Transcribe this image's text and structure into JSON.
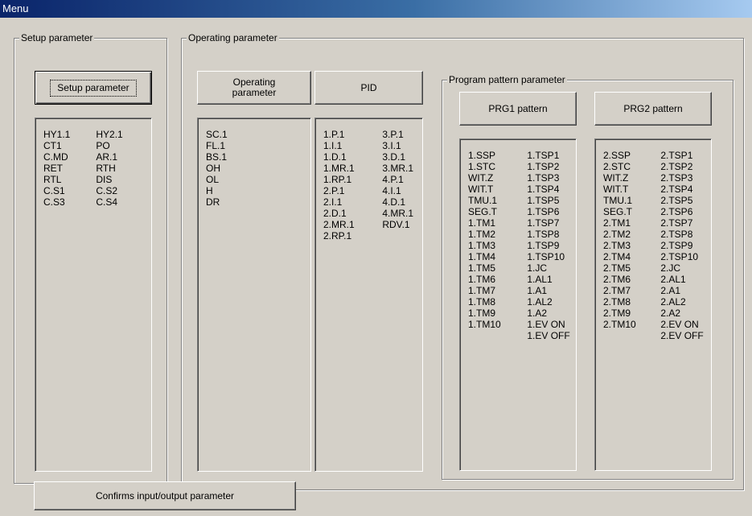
{
  "window": {
    "title": "Menu"
  },
  "setup_group": {
    "label": "Setup parameter",
    "button_label": "Setup parameter",
    "col1": [
      "HY1.1",
      "CT1",
      "C.MD",
      "RET",
      "RTL",
      "C.S1",
      "C.S3"
    ],
    "col2": [
      "HY2.1",
      "PO",
      "AR.1",
      "RTH",
      "DIS",
      "C.S2",
      "C.S4"
    ]
  },
  "operating_group": {
    "label": "Operating parameter",
    "operating_button_label": "Operating parameter",
    "operating_col": [
      "SC.1",
      "FL.1",
      "BS.1",
      "OH",
      "OL",
      "H",
      "DR"
    ],
    "pid_button_label": "PID",
    "pid_col1": [
      "1.P.1",
      "1.I.1",
      "1.D.1",
      "1.MR.1",
      "1.RP.1",
      "2.P.1",
      "2.I.1",
      "2.D.1",
      "2.MR.1",
      "2.RP.1"
    ],
    "pid_col2": [
      "3.P.1",
      "3.I.1",
      "3.D.1",
      "3.MR.1",
      "4.P.1",
      "4.I.1",
      "4.D.1",
      "4.MR.1",
      "RDV.1"
    ]
  },
  "program_group": {
    "label": "Program pattern parameter",
    "prg1_button_label": "PRG1 pattern",
    "prg1_col1": [
      "1.SSP",
      "1.STC",
      "WIT.Z",
      "WIT.T",
      "TMU.1",
      "SEG.T",
      "1.TM1",
      "1.TM2",
      "1.TM3",
      "1.TM4",
      "1.TM5",
      "1.TM6",
      "1.TM7",
      "1.TM8",
      "1.TM9",
      "1.TM10"
    ],
    "prg1_col2": [
      "1.TSP1",
      "1.TSP2",
      "1.TSP3",
      "1.TSP4",
      "1.TSP5",
      "1.TSP6",
      "1.TSP7",
      "1.TSP8",
      "1.TSP9",
      "1.TSP10",
      "1.JC",
      "1.AL1",
      "1.A1",
      "1.AL2",
      "1.A2",
      "1.EV ON",
      "1.EV OFF"
    ],
    "prg2_button_label": "PRG2 pattern",
    "prg2_col1": [
      "2.SSP",
      "2.STC",
      "WIT.Z",
      "WIT.T",
      "TMU.1",
      "SEG.T",
      "2.TM1",
      "2.TM2",
      "2.TM3",
      "2.TM4",
      "2.TM5",
      "2.TM6",
      "2.TM7",
      "2.TM8",
      "2.TM9",
      "2.TM10"
    ],
    "prg2_col2": [
      "2.TSP1",
      "2.TSP2",
      "2.TSP3",
      "2.TSP4",
      "2.TSP5",
      "2.TSP6",
      "2.TSP7",
      "2.TSP8",
      "2.TSP9",
      "2.TSP10",
      "2.JC",
      "2.AL1",
      "2.A1",
      "2.AL2",
      "2.A2",
      "2.EV ON",
      "2.EV OFF"
    ]
  },
  "footer": {
    "confirm_button_label": "Confirms input/output parameter"
  }
}
